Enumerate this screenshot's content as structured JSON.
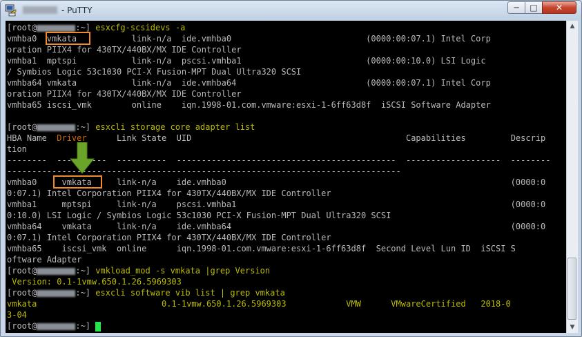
{
  "window": {
    "title": "- PuTTY"
  },
  "controls": {
    "minimize": "─",
    "maximize": "□",
    "close": "✕"
  },
  "terminal": {
    "lines": [
      {
        "prefix": "[root@",
        "mid": ":~]",
        "cmd": " esxcfg-scsidevs -a"
      },
      {
        "text": "vmhba0  vmkata           link-n/a  ide.vmhba0                           (0000:00:07.1) Intel Corp"
      },
      {
        "text": "oration PIIX4 for 430TX/440BX/MX IDE Controller"
      },
      {
        "text": "vmhba1  mptspi           link-n/a  pscsi.vmhba1                         (0000:00:10.0) LSI Logic"
      },
      {
        "text": "/ Symbios Logic 53c1030 PCI-X Fusion-MPT Dual Ultra320 SCSI"
      },
      {
        "text": "vmhba64 vmkata           link-n/a  ide.vmhba64                          (0000:00:07.1) Intel Corp"
      },
      {
        "text": "oration PIIX4 for 430TX/440BX/MX IDE Controller"
      },
      {
        "text": "vmhba65 iscsi_vmk        online    iqn.1998-01.com.vmware:esxi-1-6ff63d8f  iSCSI Software Adapter"
      },
      {
        "text": ""
      },
      {
        "prefix": "[root@",
        "mid": ":~]",
        "cmd": " esxcli storage core adapter list"
      },
      {
        "text": "HBA Name  ",
        "highlight": "Driver",
        "rest": "      Link State  UID                                           Capabilities         Descrip"
      },
      {
        "text": "tion"
      },
      {
        "text": "--------  ----------  ----------  --------------------------------------------  -------------------  --------"
      },
      {
        "text": "-------------------------------------------------------------------------------"
      },
      {
        "text": "vmhba0     vmkata     link-n/a    ide.vmhba0                                                         (0000:0"
      },
      {
        "text": "0:07.1) Intel Corporation PIIX4 for 430TX/440BX/MX IDE Controller"
      },
      {
        "text": "vmhba1     mptspi     link-n/a    pscsi.vmhba1                                                       (0000:0"
      },
      {
        "text": "0:10.0) LSI Logic / Symbios Logic 53c1030 PCI-X Fusion-MPT Dual Ultra320 SCSI"
      },
      {
        "text": "vmhba64    vmkata     link-n/a    ide.vmhba64                                                        (0000:0"
      },
      {
        "text": "0:07.1) Intel Corporation PIIX4 for 430TX/440BX/MX IDE Controller"
      },
      {
        "text": "vmhba65    iscsi_vmk  online      iqn.1998-01.com.vmware:esxi-1-6ff63d8f  Second Level Lun ID  iSCSI S"
      },
      {
        "text": "oftware Adapter"
      },
      {
        "prefix": "[root@",
        "mid": ":~]",
        "cmd": " vmkload_mod -s vmkata |grep Version"
      },
      {
        "yellow": " Version: 0.1-1vmw.650.1.26.5969303"
      },
      {
        "prefix": "[root@",
        "mid": ":~]",
        "cmd": " esxcli software vib list | grep vmkata"
      },
      {
        "yellow": "vmkata                         0.1-1vmw.650.1.26.5969303            VMW      VMwareCertified   2018-0"
      },
      {
        "yellow": "3-04"
      },
      {
        "prefix": "[root@",
        "mid": ":~]",
        "cmd": " ",
        "cursor": true
      }
    ]
  },
  "colors": {
    "background": "#000000",
    "text": "#bbbbbb",
    "prompt_yellow": "#bbbb00",
    "highlight_box": "#f28c28",
    "arrow": "#6aa52a",
    "cursor": "#26e34b"
  }
}
